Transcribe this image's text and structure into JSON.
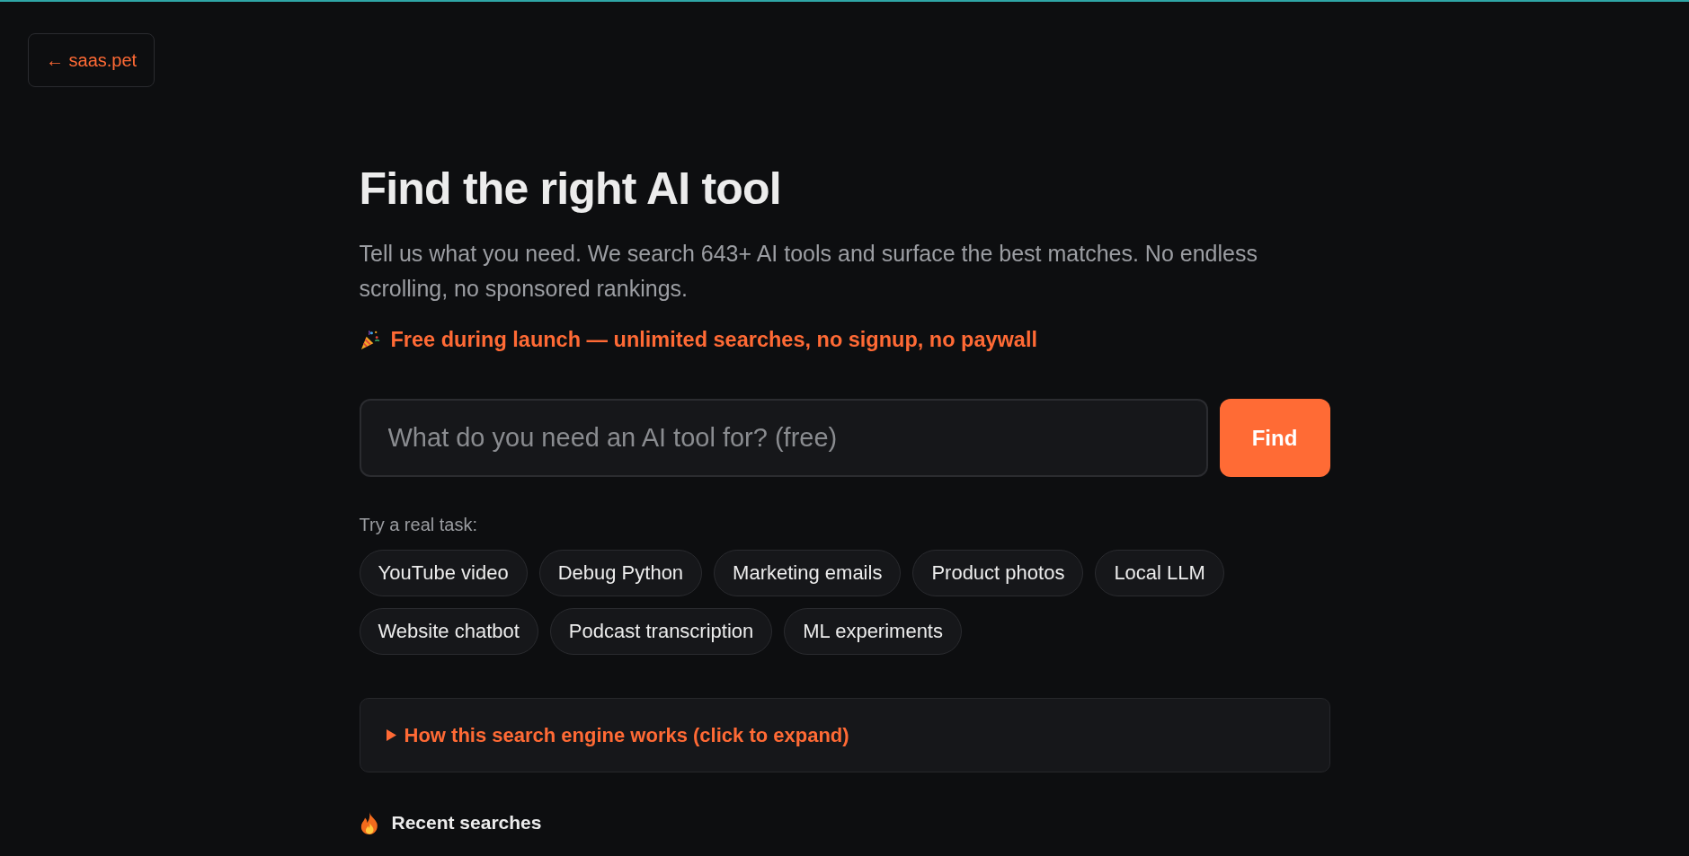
{
  "back_link": {
    "label": "← saas.pet"
  },
  "hero": {
    "title": "Find the right AI tool",
    "subtitle": "Tell us what you need. We search 643+ AI tools and surface the best matches. No endless scrolling, no sponsored rankings.",
    "launch_note": "Free during launch — unlimited searches, no signup, no paywall"
  },
  "search": {
    "placeholder": "What do you need an AI tool for? (free)",
    "button": "Find"
  },
  "suggestions": {
    "label": "Try a real task:",
    "chips": [
      "YouTube video",
      "Debug Python",
      "Marketing emails",
      "Product photos",
      "Local LLM",
      "Website chatbot",
      "Podcast transcription",
      "ML experiments"
    ]
  },
  "explainer": {
    "summary": "How this search engine works (click to expand)",
    "expanded": false
  },
  "recent_searches": {
    "title": "Recent searches"
  }
}
